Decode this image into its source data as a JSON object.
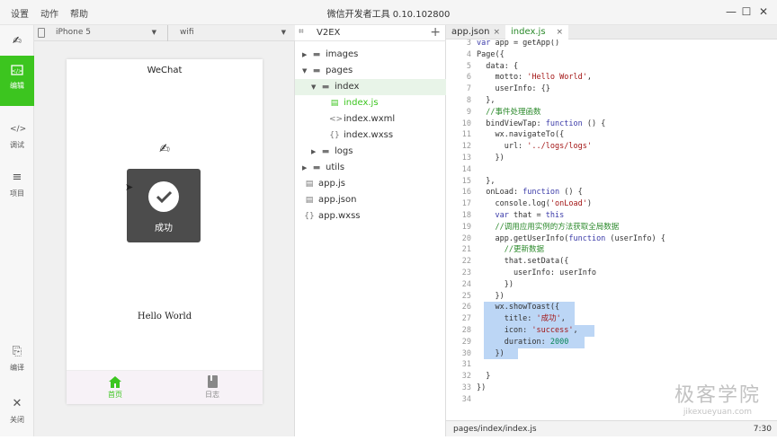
{
  "menu": [
    "设置",
    "动作",
    "帮助"
  ],
  "window_title": "微信开发者工具 0.10.102800",
  "leftbar": {
    "edit_label": "编辑",
    "debug_label": "调试",
    "project_label": "项目",
    "compile_label": "编译",
    "close_label": "关闭"
  },
  "device": {
    "model": "iPhone 5",
    "network": "wifi"
  },
  "phone": {
    "nav_title": "WeChat",
    "toast_title": "成功",
    "motto": "Hello World",
    "tabs": [
      {
        "label": "首页"
      },
      {
        "label": "日志"
      }
    ]
  },
  "filetree": {
    "project": "V2EX",
    "items": [
      "images",
      "pages",
      "index",
      "index.js",
      "index.wxml",
      "index.wxss",
      "logs",
      "utils",
      "app.js",
      "app.json",
      "app.wxss"
    ]
  },
  "editor": {
    "tabs": [
      "app.json",
      "index.js"
    ],
    "lines": [
      {
        "n": "3",
        "t": "var app = getApp()"
      },
      {
        "n": "4",
        "t": "Page({"
      },
      {
        "n": "5",
        "t": "  data: {"
      },
      {
        "n": "6",
        "t": "    motto: 'Hello World',"
      },
      {
        "n": "7",
        "t": "    userInfo: {}"
      },
      {
        "n": "8",
        "t": "  },"
      },
      {
        "n": "9",
        "t": "  //事件处理函数"
      },
      {
        "n": "10",
        "t": "  bindViewTap: function () {"
      },
      {
        "n": "11",
        "t": "    wx.navigateTo({"
      },
      {
        "n": "12",
        "t": "      url: '../logs/logs'"
      },
      {
        "n": "13",
        "t": "    })"
      },
      {
        "n": "14",
        "t": ""
      },
      {
        "n": "15",
        "t": "  },"
      },
      {
        "n": "16",
        "t": "  onLoad: function () {"
      },
      {
        "n": "17",
        "t": "    console.log('onLoad')"
      },
      {
        "n": "18",
        "t": "    var that = this"
      },
      {
        "n": "19",
        "t": "    //调用应用实例的方法获取全局数据"
      },
      {
        "n": "20",
        "t": "    app.getUserInfo(function (userInfo) {"
      },
      {
        "n": "21",
        "t": "      //更新数据"
      },
      {
        "n": "22",
        "t": "      that.setData({"
      },
      {
        "n": "23",
        "t": "        userInfo: userInfo"
      },
      {
        "n": "24",
        "t": "      })"
      },
      {
        "n": "25",
        "t": "    })"
      },
      {
        "n": "26",
        "t": "    wx.showToast({"
      },
      {
        "n": "27",
        "t": "      title: '成功',"
      },
      {
        "n": "28",
        "t": "      icon: 'success',"
      },
      {
        "n": "29",
        "t": "      duration: 2000"
      },
      {
        "n": "30",
        "t": "    })"
      },
      {
        "n": "31",
        "t": ""
      },
      {
        "n": "32",
        "t": "  }"
      },
      {
        "n": "33",
        "t": "})"
      },
      {
        "n": "34",
        "t": ""
      }
    ],
    "status_path": "pages/index/index.js",
    "status_pos": "7:30"
  },
  "watermark": {
    "cn": "极客学院",
    "url": "jikexueyuan.com"
  },
  "colors": {
    "accent": "#3cc51f",
    "toast": "#4c4c4c",
    "selection": "#bcd6f5"
  }
}
